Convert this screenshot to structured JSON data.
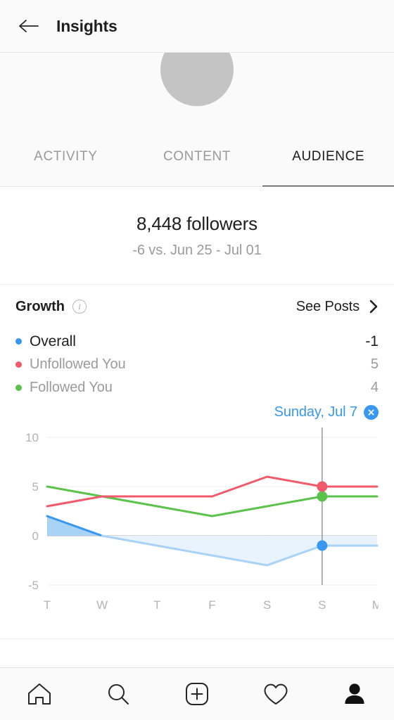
{
  "header": {
    "title": "Insights",
    "back_icon": "arrow-left-icon"
  },
  "profile": {
    "avatar_placeholder": "avatar-skeleton",
    "name_placeholder": "name-skeleton",
    "skeleton_color": "#c4c4c4"
  },
  "tabs": [
    {
      "label": "ACTIVITY",
      "active": false
    },
    {
      "label": "CONTENT",
      "active": false
    },
    {
      "label": "AUDIENCE",
      "active": true
    }
  ],
  "summary": {
    "count": "8,448 followers",
    "delta": "-6 vs. Jun 25 - Jul 01"
  },
  "growth": {
    "title": "Growth",
    "info_icon": "info-icon",
    "see_posts_label": "See Posts",
    "chevron_icon": "chevron-right-icon"
  },
  "legend": [
    {
      "label": "Overall",
      "value": "-1",
      "color": "#3897f0",
      "primary": true
    },
    {
      "label": "Unfollowed You",
      "value": "5",
      "color": "#f2596b",
      "primary": false
    },
    {
      "label": "Followed You",
      "value": "4",
      "color": "#5bc24a",
      "primary": false
    }
  ],
  "selection": {
    "label": "Sunday, Jul 7",
    "close_icon": "close-icon",
    "accent": "#3897f0"
  },
  "chart_data": {
    "type": "line",
    "title": "Growth",
    "xlabel": "",
    "ylabel": "",
    "ylim": [
      -5,
      10
    ],
    "yticks": [
      10,
      5,
      0,
      -5
    ],
    "ytick_labels": [
      "10",
      "5",
      "0",
      "-5"
    ],
    "grid": true,
    "legend_position": "above-chart",
    "categories": [
      "T",
      "W",
      "T",
      "F",
      "S",
      "S",
      "M"
    ],
    "x": [
      "T",
      "W",
      "T",
      "F",
      "S",
      "S",
      "M"
    ],
    "selected_index": 5,
    "selected_label": "Sunday, Jul 7",
    "series": [
      {
        "name": "Followed You",
        "color": "#5bc24a",
        "values": [
          5,
          4,
          3,
          2,
          3,
          4,
          4
        ],
        "marker_at_selected": 4
      },
      {
        "name": "Unfollowed You",
        "color": "#f2596b",
        "values": [
          3,
          4,
          4,
          4,
          6,
          5,
          5
        ],
        "marker_at_selected": 5
      },
      {
        "name": "Overall",
        "color": "#3897f0",
        "values": [
          2,
          0,
          -1,
          -2,
          -3,
          -1,
          -1
        ],
        "marker_at_selected": -1,
        "area_fill_positive": "#a8d3f7",
        "area_fill_negative": "#e8f3fd"
      }
    ]
  },
  "bottom_nav": [
    {
      "icon": "home-icon",
      "active": false
    },
    {
      "icon": "search-icon",
      "active": false
    },
    {
      "icon": "add-post-icon",
      "active": false
    },
    {
      "icon": "heart-icon",
      "active": false
    },
    {
      "icon": "profile-icon",
      "active": true
    }
  ]
}
